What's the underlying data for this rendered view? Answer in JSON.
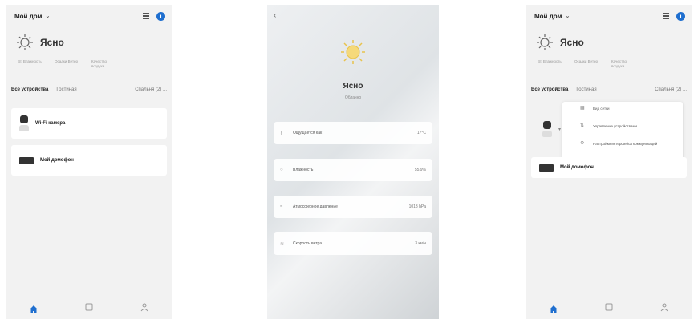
{
  "screens": [
    {
      "home_name": "Мой дом",
      "weather_label": "Ясно",
      "stats": [
        "Вт. Влажность",
        "Осадки Ветер",
        "Качество воздуха"
      ],
      "tabs": [
        "Все устройства",
        "Гостиная",
        "Спальня"
      ],
      "more_label": "Спальня (2) ...",
      "devices": [
        "Wi-Fi камера",
        "Мой домофон"
      ]
    },
    {
      "title": "Ясно",
      "subtitle": "Облачно",
      "rows": [
        {
          "label": "Ощущается как",
          "value": "17°C"
        },
        {
          "label": "Влажность",
          "value": "55.9%"
        },
        {
          "label": "Атмосферное давление",
          "value": "1013 hPa"
        },
        {
          "label": "Скорость ветра",
          "value": "3 км/ч"
        }
      ]
    },
    {
      "home_name": "Мой дом",
      "weather_label": "Ясно",
      "stats": [
        "Вт. Влажность",
        "Осадки Ветер",
        "Качество воздуха"
      ],
      "tabs": [
        "Все устройства",
        "Гостиная"
      ],
      "more_label": "Спальня (2) ...",
      "menu": [
        "Вид сетки",
        "Управление устройствами",
        "Настройки интерфейса коммуникаций"
      ],
      "devices": [
        "Мой домофон"
      ]
    }
  ],
  "colors": {
    "accent": "#1f6fcf",
    "nav_active": "#1f6fcf"
  }
}
